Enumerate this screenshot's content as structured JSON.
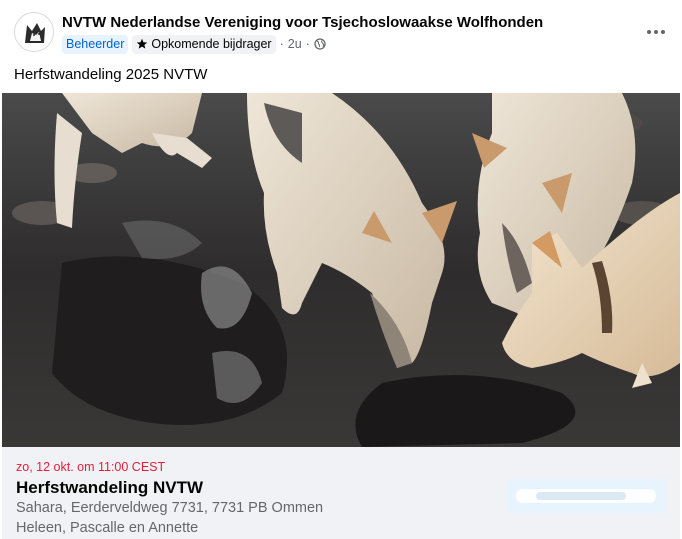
{
  "post": {
    "group_name": "NVTW Nederlandse Vereniging voor Tsjechoslowaakse Wolfhonden",
    "badge_admin": "Beheerder",
    "badge_contributor": "Opkomende bijdrager",
    "separator": "·",
    "time": "2u",
    "text": "Herfstwandeling 2025 NVTW",
    "more_icon": "more-horizontal-icon",
    "audience_icon": "globe-icon"
  },
  "event": {
    "date": "zo, 12 okt. om 11:00 CEST",
    "title": "Herfstwandeling NVTW",
    "location": "Sahara, Eerderveldweg 7731, 7731 PB Ommen",
    "hosts": "Heleen, Pascalle en Annette"
  },
  "colors": {
    "admin_badge_text": "#0064d1",
    "event_date": "#e41e3f",
    "event_bg": "#f0f2f5"
  }
}
